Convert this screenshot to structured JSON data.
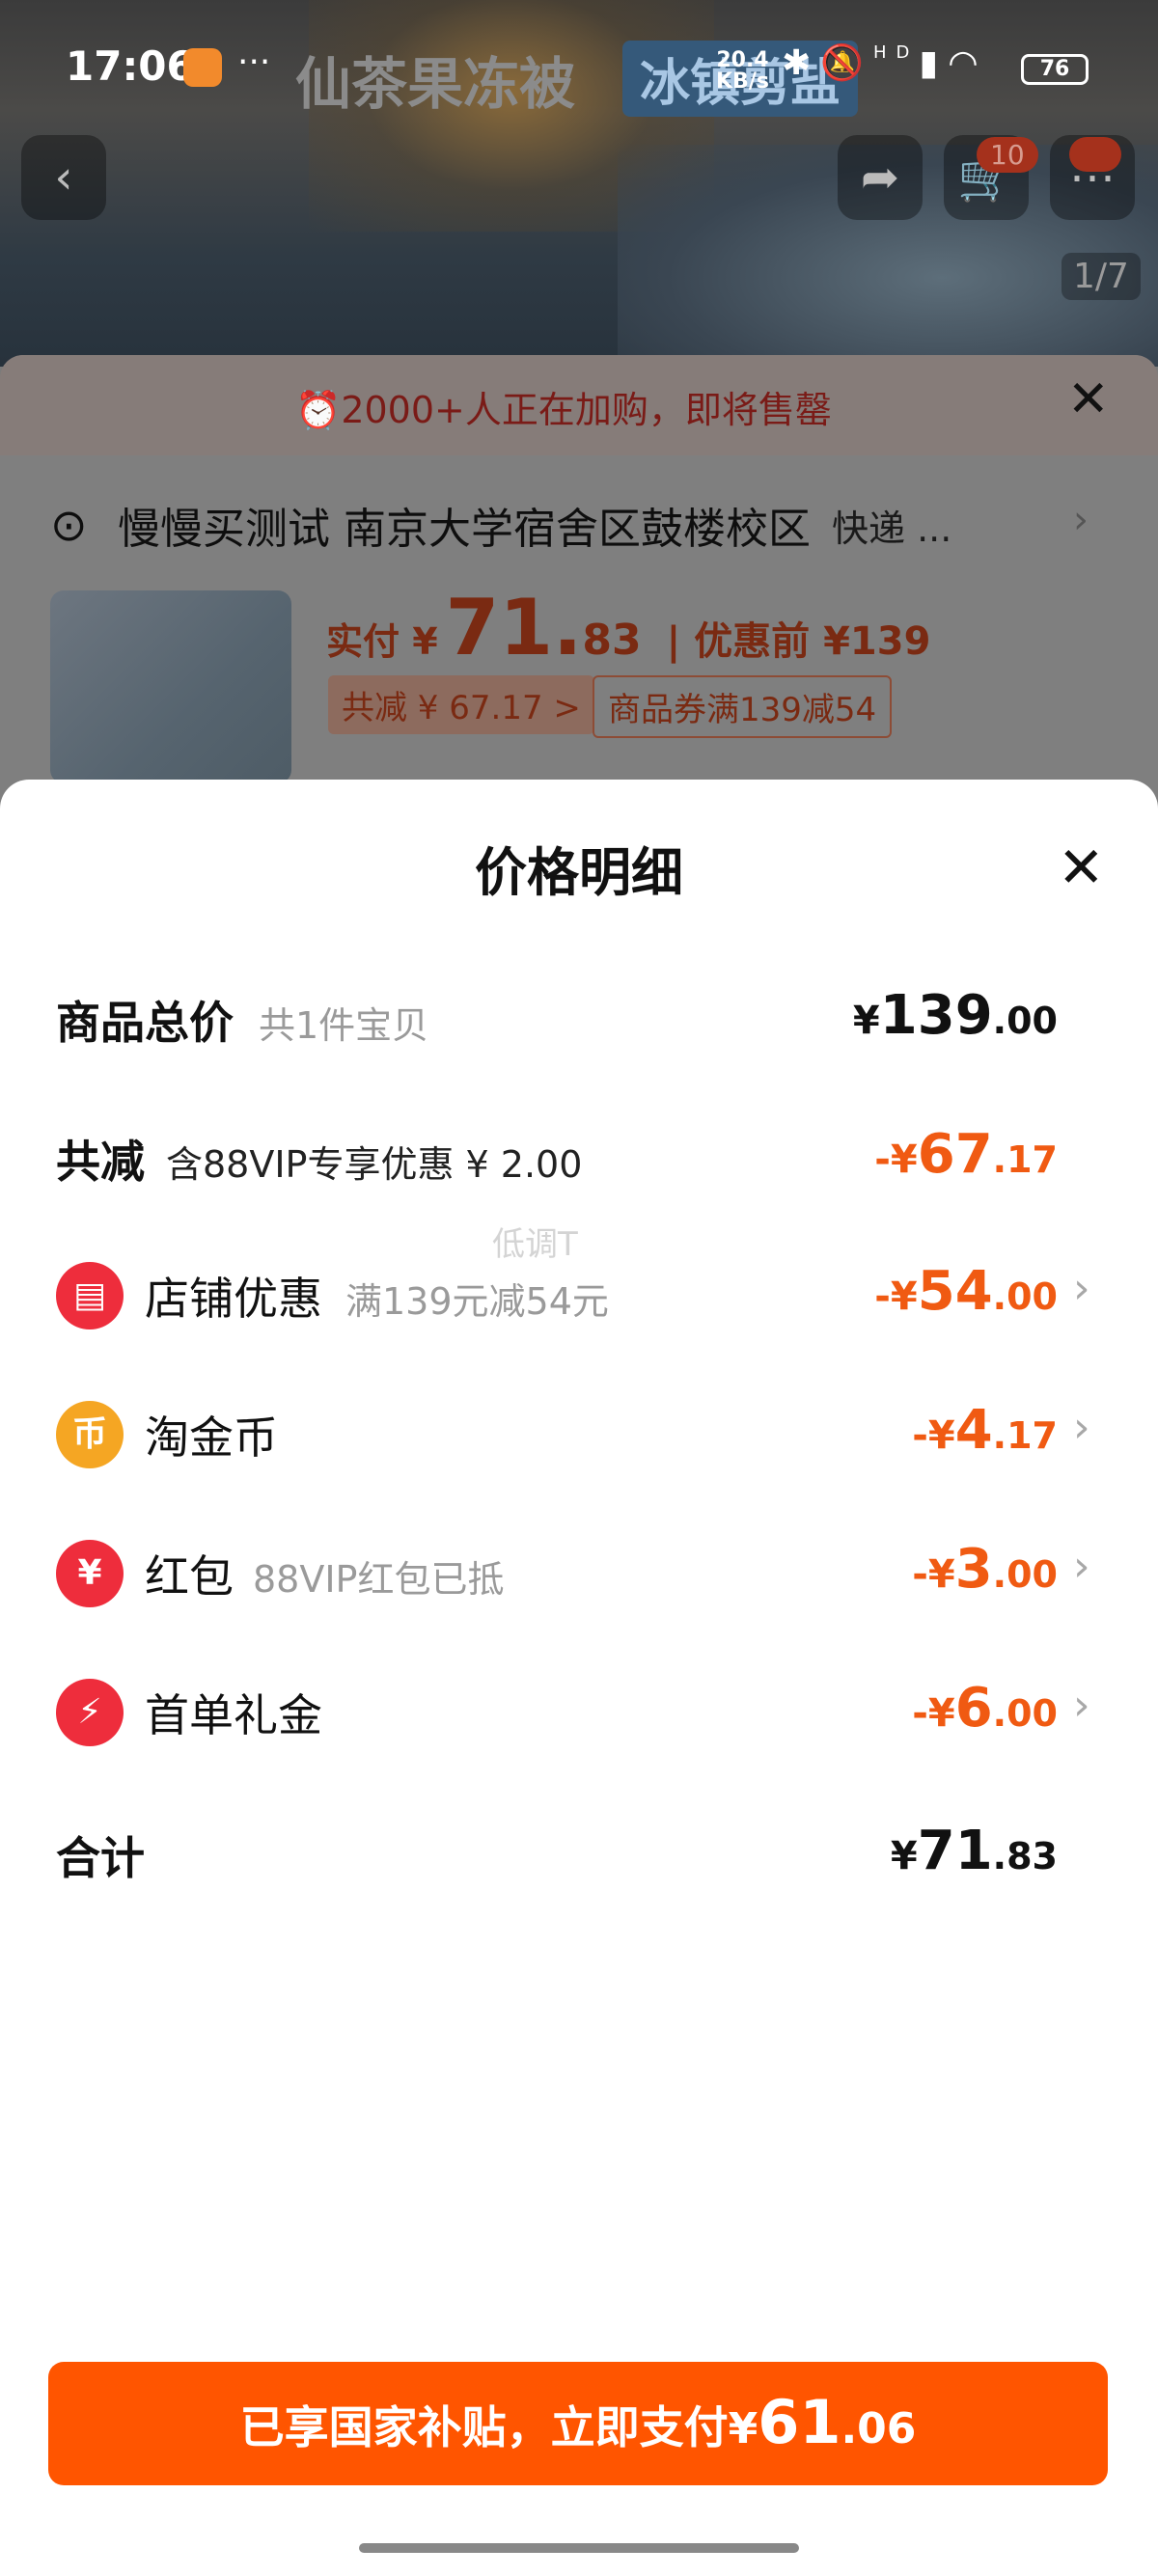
{
  "status_bar": {
    "time": "17:06",
    "overflow": "···",
    "title": "仙茶果冻被",
    "tag": "冰镇剪盐",
    "speed_value": "20.4",
    "speed_unit": "KB/s",
    "signal_label": "HD",
    "battery": "76"
  },
  "product_page": {
    "cart_count": "10",
    "image_index": "1/7",
    "promo_banner": "2000+人正在加购，即将售罄",
    "address": "慢慢买测试 南京大学宿舍区鼓楼校区",
    "shipping": "快递 ...",
    "price_label": "实付 ¥",
    "price_int": "71.",
    "price_dec": "83",
    "price_before": "| 优惠前 ¥139",
    "save_chip": "共减 ¥ 67.17 >",
    "coupon_chip": "商品券满139减54"
  },
  "sheet": {
    "title": "价格明细",
    "rows": [
      {
        "label": "商品总价",
        "sub": "共1件宝贝",
        "currency": "¥",
        "int": "139",
        "dec": ".00"
      },
      {
        "label": "共减",
        "sub": "含88VIP专享优惠 ¥ 2.00",
        "currency": "-¥",
        "int": "67",
        "dec": ".17"
      },
      {
        "label": "店铺优惠",
        "sub": "满139元减54元",
        "currency": "-¥",
        "int": "54",
        "dec": ".00",
        "icon_char": "▤",
        "icon_color": "#ee2d3c"
      },
      {
        "label": "淘金币",
        "sub": "",
        "currency": "-¥",
        "int": "4",
        "dec": ".17",
        "icon_char": "币",
        "icon_color": "#f5a623"
      },
      {
        "label": "红包",
        "sub": "88VIP红包已抵",
        "currency": "-¥",
        "int": "3",
        "dec": ".00",
        "icon_char": "¥",
        "icon_color": "#ee2d3c"
      },
      {
        "label": "首单礼金",
        "sub": "",
        "currency": "-¥",
        "int": "6",
        "dec": ".00",
        "icon_char": "⚡",
        "icon_color": "#ee2d3c"
      },
      {
        "label": "合计",
        "sub": "",
        "currency": "¥",
        "int": "71",
        "dec": ".83"
      }
    ],
    "watermark": "低调T",
    "pay_button": {
      "text": "已享国家补贴，立即支付",
      "currency": "¥",
      "int": "61",
      "dec": ".06"
    }
  },
  "colors": {
    "accent": "#ff5500",
    "discount": "#f05a12"
  }
}
